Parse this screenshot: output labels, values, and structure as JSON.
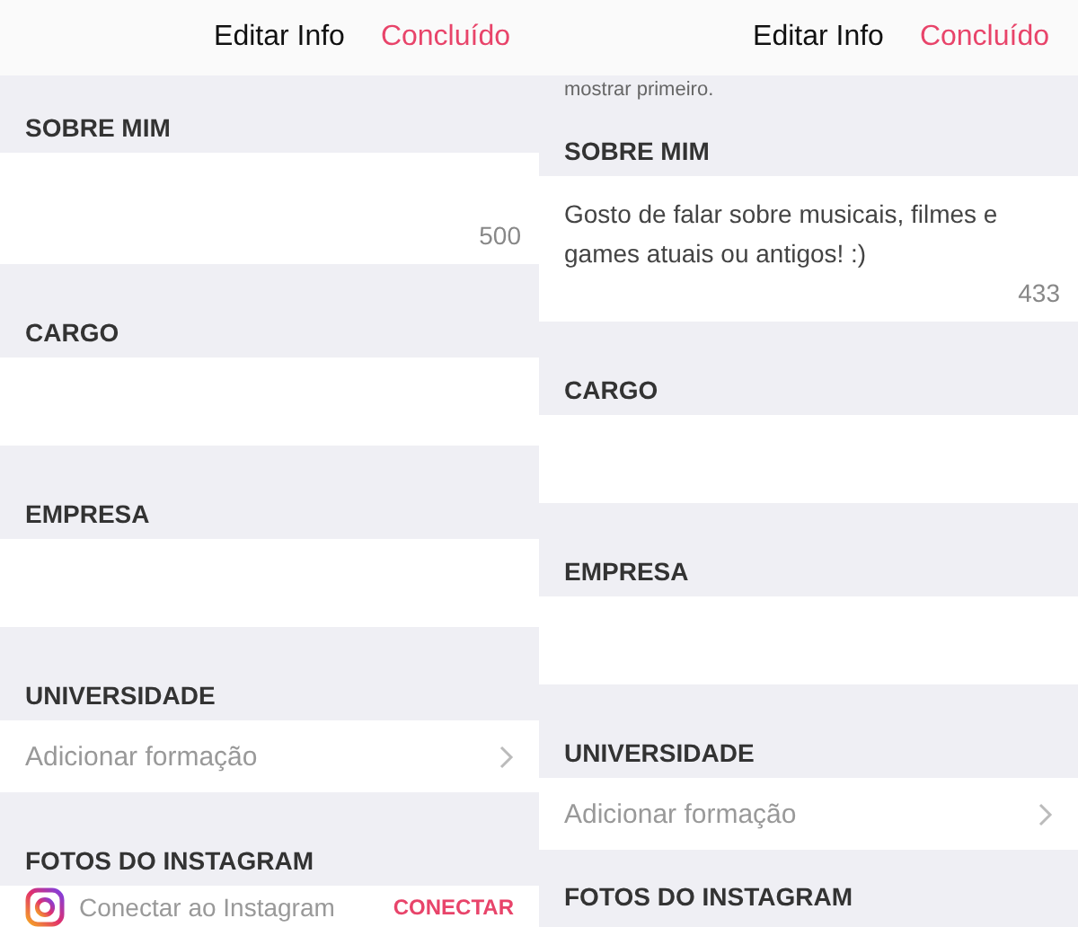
{
  "panels": [
    {
      "header": {
        "title": "Editar Info",
        "action": "Concluído"
      },
      "sections": [
        {
          "label": "SOBRE MIM",
          "kind": "textarea",
          "counter": "500"
        },
        {
          "label": "CARGO",
          "kind": "input"
        },
        {
          "label": "EMPRESA",
          "kind": "input"
        },
        {
          "label": "UNIVERSIDADE",
          "kind": "link",
          "placeholder": "Adicionar formação"
        },
        {
          "label": "FOTOS DO INSTAGRAM",
          "kind": "instagram",
          "text": "Conectar ao Instagram",
          "action": "CONECTAR"
        }
      ]
    },
    {
      "header": {
        "title": "Editar Info",
        "action": "Concluído"
      },
      "note": "mostrar primeiro.",
      "sections": [
        {
          "label": "SOBRE MIM",
          "kind": "textarea",
          "value": "Gosto de falar sobre musicais, filmes e games atuais ou antigos! :)",
          "counter": "433"
        },
        {
          "label": "CARGO",
          "kind": "input"
        },
        {
          "label": "EMPRESA",
          "kind": "input"
        },
        {
          "label": "UNIVERSIDADE",
          "kind": "link",
          "placeholder": "Adicionar formação"
        },
        {
          "label": "FOTOS DO INSTAGRAM",
          "kind": "none"
        }
      ]
    }
  ]
}
